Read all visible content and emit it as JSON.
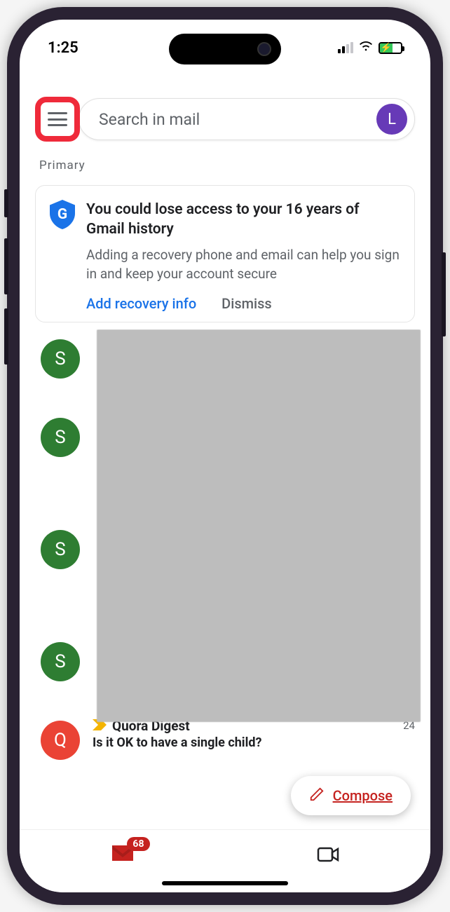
{
  "status_bar": {
    "time": "1:25"
  },
  "search": {
    "placeholder": "Search in mail",
    "profile_initial": "L"
  },
  "section_label": "Primary",
  "alert": {
    "title": "You could lose access to your 16 years of Gmail history",
    "body": "Adding a recovery phone and email can help you sign in and keep your account secure",
    "primary_action": "Add recovery info",
    "secondary_action": "Dismiss"
  },
  "emails": [
    {
      "avatar": "S",
      "avatar_color": "green",
      "blurred": true
    },
    {
      "avatar": "S",
      "avatar_color": "green",
      "blurred": true,
      "tall": true
    },
    {
      "avatar": "S",
      "avatar_color": "green",
      "blurred": true,
      "tall": true
    },
    {
      "avatar": "S",
      "avatar_color": "green",
      "blurred": true
    },
    {
      "avatar": "Q",
      "avatar_color": "red",
      "blurred": false,
      "sender": "Quora Digest",
      "date": "24",
      "subject": "Is it OK to have a single child?"
    }
  ],
  "compose_label": "Compose",
  "nav": {
    "mail_badge": "68"
  }
}
